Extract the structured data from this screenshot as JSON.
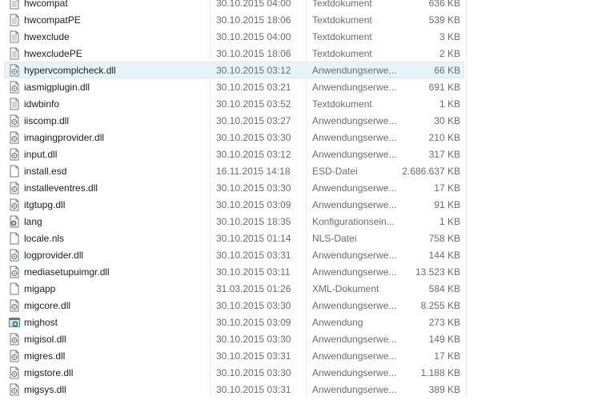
{
  "files": [
    {
      "name": "hwcompat",
      "date": "30.10.2015 04:00",
      "type": "Textdokument",
      "size": "636 KB",
      "icon": "text-document-icon"
    },
    {
      "name": "hwcompatPE",
      "date": "30.10.2015 18:06",
      "type": "Textdokument",
      "size": "539 KB",
      "icon": "text-document-icon"
    },
    {
      "name": "hwexclude",
      "date": "30.10.2015 04:00",
      "type": "Textdokument",
      "size": "3 KB",
      "icon": "text-document-icon"
    },
    {
      "name": "hwexcludePE",
      "date": "30.10.2015 18:06",
      "type": "Textdokument",
      "size": "2 KB",
      "icon": "text-document-icon"
    },
    {
      "name": "hypervcomplcheck.dll",
      "date": "30.10.2015 03:12",
      "type": "Anwendungserwe...",
      "size": "66 KB",
      "icon": "dll-file-icon",
      "hover": true
    },
    {
      "name": "iasmigplugin.dll",
      "date": "30.10.2015 03:21",
      "type": "Anwendungserwe...",
      "size": "691 KB",
      "icon": "dll-file-icon"
    },
    {
      "name": "idwbinfo",
      "date": "30.10.2015 03:52",
      "type": "Textdokument",
      "size": "1 KB",
      "icon": "text-document-icon"
    },
    {
      "name": "iiscomp.dll",
      "date": "30.10.2015 03:27",
      "type": "Anwendungserwe...",
      "size": "30 KB",
      "icon": "dll-file-icon"
    },
    {
      "name": "imagingprovider.dll",
      "date": "30.10.2015 03:30",
      "type": "Anwendungserwe...",
      "size": "210 KB",
      "icon": "dll-file-icon"
    },
    {
      "name": "input.dll",
      "date": "30.10.2015 03:12",
      "type": "Anwendungserwe...",
      "size": "317 KB",
      "icon": "dll-file-icon"
    },
    {
      "name": "install.esd",
      "date": "16.11.2015 14:18",
      "type": "ESD-Datei",
      "size": "2.686.637 KB",
      "icon": "blank-file-icon"
    },
    {
      "name": "installeventres.dll",
      "date": "30.10.2015 03:30",
      "type": "Anwendungserwe...",
      "size": "17 KB",
      "icon": "dll-file-icon"
    },
    {
      "name": "itgtupg.dll",
      "date": "30.10.2015 03:09",
      "type": "Anwendungserwe...",
      "size": "91 KB",
      "icon": "dll-file-icon"
    },
    {
      "name": "lang",
      "date": "30.10.2015 18:35",
      "type": "Konfigurationsein...",
      "size": "1 KB",
      "icon": "config-file-icon"
    },
    {
      "name": "locale.nls",
      "date": "30.10.2015 01:14",
      "type": "NLS-Datei",
      "size": "758 KB",
      "icon": "blank-file-icon"
    },
    {
      "name": "logprovider.dll",
      "date": "30.10.2015 03:31",
      "type": "Anwendungserwe...",
      "size": "144 KB",
      "icon": "dll-file-icon"
    },
    {
      "name": "mediasetupuimgr.dll",
      "date": "30.10.2015 03:11",
      "type": "Anwendungserwe...",
      "size": "13.523 KB",
      "icon": "dll-file-icon"
    },
    {
      "name": "migapp",
      "date": "31.03.2015 01:26",
      "type": "XML-Dokument",
      "size": "584 KB",
      "icon": "blank-file-icon"
    },
    {
      "name": "migcore.dll",
      "date": "30.10.2015 03:30",
      "type": "Anwendungserwe...",
      "size": "8.255 KB",
      "icon": "dll-file-icon"
    },
    {
      "name": "mighost",
      "date": "30.10.2015 03:09",
      "type": "Anwendung",
      "size": "273 KB",
      "icon": "application-icon"
    },
    {
      "name": "migisol.dll",
      "date": "30.10.2015 03:30",
      "type": "Anwendungserwe...",
      "size": "149 KB",
      "icon": "dll-file-icon"
    },
    {
      "name": "migres.dll",
      "date": "30.10.2015 03:31",
      "type": "Anwendungserwe...",
      "size": "17 KB",
      "icon": "dll-file-icon"
    },
    {
      "name": "migstore.dll",
      "date": "30.10.2015 03:30",
      "type": "Anwendungserwe...",
      "size": "1.188 KB",
      "icon": "dll-file-icon"
    },
    {
      "name": "migsys.dll",
      "date": "30.10.2015 03:31",
      "type": "Anwendungserwe...",
      "size": "389 KB",
      "icon": "dll-file-icon"
    }
  ]
}
